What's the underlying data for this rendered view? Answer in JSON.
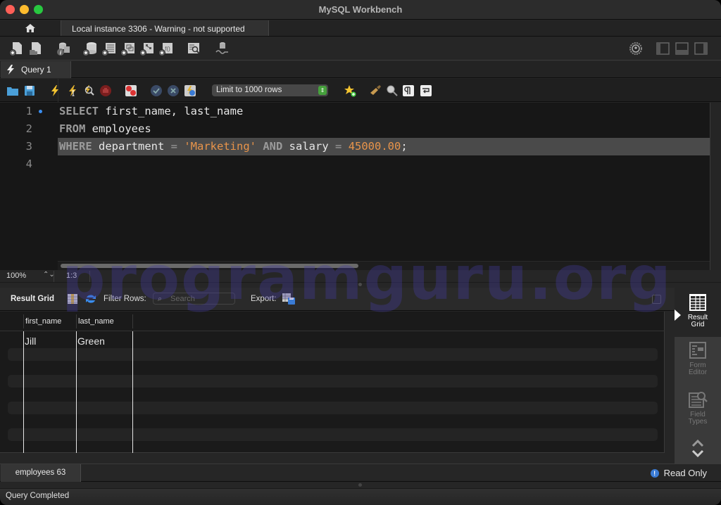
{
  "window": {
    "title": "MySQL Workbench"
  },
  "connection_tabs": {
    "home_icon": "home-icon",
    "active_tab": "Local instance 3306 - Warning - not supported"
  },
  "main_toolbar": {
    "left_icons": [
      "new-sql-tab-icon",
      "open-sql-script-icon",
      "schema-inspector-icon",
      "create-schema-icon",
      "create-table-icon",
      "create-view-icon",
      "create-procedure-icon",
      "create-function-icon",
      "search-table-data-icon",
      "reconnect-dbms-icon"
    ],
    "right_icons": [
      "preferences-icon",
      "toggle-sidebar-icon",
      "toggle-output-icon",
      "toggle-secondary-sidebar-icon"
    ]
  },
  "query_tab": {
    "label": "Query 1",
    "icon": "lightning-icon"
  },
  "sql_toolbar": {
    "icons": [
      "open-file-icon",
      "save-icon",
      "execute-icon",
      "execute-current-icon",
      "explain-icon",
      "stop-icon",
      "toggle-error-stop-icon",
      "commit-icon",
      "rollback-icon",
      "autocommit-icon"
    ],
    "limit_select": "Limit to 1000 rows",
    "right_icons": [
      "add-snippet-icon",
      "beautify-icon",
      "find-icon",
      "invisible-chars-icon",
      "word-wrap-icon"
    ]
  },
  "editor": {
    "lines": [
      {
        "number": "1",
        "marker": true,
        "tokens": [
          {
            "t": "kw",
            "v": "SELECT"
          },
          {
            "t": "id",
            "v": " first_name, last_name"
          }
        ]
      },
      {
        "number": "2",
        "marker": false,
        "tokens": [
          {
            "t": "kw",
            "v": "FROM"
          },
          {
            "t": "id",
            "v": " employees"
          }
        ]
      },
      {
        "number": "3",
        "marker": false,
        "current": true,
        "tokens": [
          {
            "t": "kw",
            "v": "WHERE"
          },
          {
            "t": "id",
            "v": " department "
          },
          {
            "t": "op",
            "v": "="
          },
          {
            "t": "id",
            "v": " "
          },
          {
            "t": "str",
            "v": "'Marketing'"
          },
          {
            "t": "id",
            "v": " "
          },
          {
            "t": "kw",
            "v": "AND"
          },
          {
            "t": "id",
            "v": " salary "
          },
          {
            "t": "op",
            "v": "="
          },
          {
            "t": "id",
            "v": " "
          },
          {
            "t": "num",
            "v": "45000.00"
          },
          {
            "t": "id",
            "v": ";"
          }
        ]
      },
      {
        "number": "4",
        "marker": false,
        "tokens": []
      }
    ],
    "zoom": "100%",
    "cursor_position": "1:3"
  },
  "result_toolbar": {
    "title": "Result Grid",
    "filter_label": "Filter Rows:",
    "search_placeholder": "Search",
    "export_label": "Export:"
  },
  "result_grid": {
    "columns": [
      "first_name",
      "last_name"
    ],
    "rows": [
      [
        "Jill",
        "Green"
      ]
    ]
  },
  "side_panel": {
    "items": [
      {
        "label_line1": "Result",
        "label_line2": "Grid",
        "active": true
      },
      {
        "label_line1": "Form",
        "label_line2": "Editor",
        "active": false
      },
      {
        "label_line1": "Field",
        "label_line2": "Types",
        "active": false
      }
    ]
  },
  "bottom_tabs": {
    "tab": "employees 63",
    "read_only": "Read Only"
  },
  "status_bar": {
    "text": "Query Completed"
  },
  "watermark": "programguru.org",
  "colors": {
    "keyword": "#9a9a9a",
    "string": "#e8944a",
    "number": "#e8944a",
    "current_line": "#4a4a4a",
    "editor_bg": "#171717",
    "accent_blue": "#3a7bd5"
  }
}
